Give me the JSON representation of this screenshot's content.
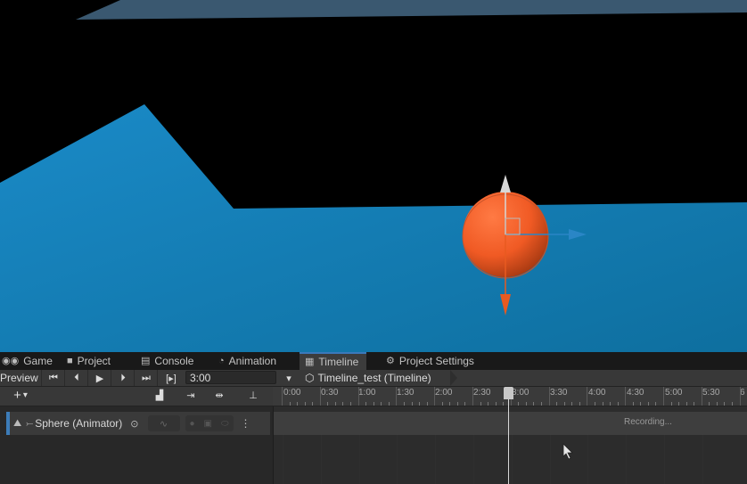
{
  "tabs": [
    {
      "label": "Game",
      "icon": "gamepad-icon"
    },
    {
      "label": "Project",
      "icon": "folder-icon"
    },
    {
      "label": "Console",
      "icon": "console-icon"
    },
    {
      "label": "Animation",
      "icon": "clock-icon"
    },
    {
      "label": "Timeline",
      "icon": "film-icon",
      "active": true
    },
    {
      "label": "Project Settings",
      "icon": "gear-icon"
    }
  ],
  "toolbar": {
    "preview_label": "Preview",
    "frame_box": "[▸]",
    "time_value": "3:00",
    "asset_name": "Timeline_test (Timeline)"
  },
  "ruler": {
    "labels": [
      "0:00",
      "0:30",
      "1:00",
      "1:30",
      "2:00",
      "2:30",
      "3:00",
      "3:30",
      "4:00",
      "4:30",
      "5:00",
      "5:30",
      "6"
    ],
    "playhead_time": "3:00"
  },
  "track": {
    "name": "Sphere (Animator)",
    "status": "Recording..."
  },
  "colors": {
    "ground": "#1a89c4",
    "sphere": "#f05a24",
    "recording_accent": "#3c7cb8"
  }
}
